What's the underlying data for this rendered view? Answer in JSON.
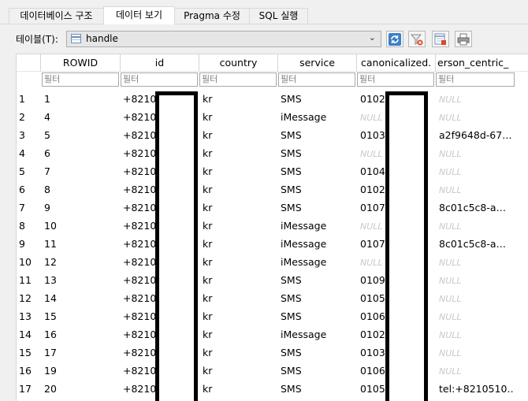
{
  "tabs": [
    {
      "label": "데이터베이스 구조",
      "active": false
    },
    {
      "label": "데이터 보기",
      "active": true
    },
    {
      "label": "Pragma 수정",
      "active": false
    },
    {
      "label": "SQL 실행",
      "active": false
    }
  ],
  "table_selector": {
    "label": "테이블(T):",
    "value": "handle"
  },
  "toolbar": {
    "buttons": [
      "refresh-icon",
      "clear-filters-icon",
      "save-table-icon",
      "print-icon"
    ]
  },
  "columns": [
    "ROWID",
    "id",
    "country",
    "service",
    "canonicalized_",
    "person_centric_"
  ],
  "column_header_display": [
    "ROWID",
    "id",
    "country",
    "service",
    "canonicalized.",
    "erson_centric_"
  ],
  "filter_placeholder": "필터",
  "null_text": "NULL",
  "rows": [
    {
      "rn": "1",
      "rowid": "1",
      "id": "+82102",
      "country": "kr",
      "service": "SMS",
      "canon": "01024",
      "person": ""
    },
    {
      "rn": "2",
      "rowid": "4",
      "id": "+82103",
      "country": "kr",
      "service": "iMessage",
      "canon": "",
      "person": ""
    },
    {
      "rn": "3",
      "rowid": "5",
      "id": "+82103",
      "country": "kr",
      "service": "SMS",
      "canon": "01031",
      "person": "a2f9648d-67…"
    },
    {
      "rn": "4",
      "rowid": "6",
      "id": "+82103",
      "country": "kr",
      "service": "SMS",
      "canon": "",
      "person": ""
    },
    {
      "rn": "5",
      "rowid": "7",
      "id": "+82104",
      "country": "kr",
      "service": "SMS",
      "canon": "01041",
      "person": ""
    },
    {
      "rn": "6",
      "rowid": "8",
      "id": "+82102",
      "country": "kr",
      "service": "SMS",
      "canon": "01028",
      "person": ""
    },
    {
      "rn": "7",
      "rowid": "9",
      "id": "+82107",
      "country": "kr",
      "service": "SMS",
      "canon": "01072",
      "person": "8c01c5c8-a…"
    },
    {
      "rn": "8",
      "rowid": "10",
      "id": "+82102",
      "country": "kr",
      "service": "iMessage",
      "canon": "",
      "person": ""
    },
    {
      "rn": "9",
      "rowid": "11",
      "id": "+82107",
      "country": "kr",
      "service": "iMessage",
      "canon": "01072",
      "person": "8c01c5c8-a…"
    },
    {
      "rn": "10",
      "rowid": "12",
      "id": "+82105",
      "country": "kr",
      "service": "iMessage",
      "canon": "",
      "person": ""
    },
    {
      "rn": "11",
      "rowid": "13",
      "id": "+82109",
      "country": "kr",
      "service": "SMS",
      "canon": "01095",
      "person": ""
    },
    {
      "rn": "12",
      "rowid": "14",
      "id": "+82105",
      "country": "kr",
      "service": "SMS",
      "canon": "01050",
      "person": ""
    },
    {
      "rn": "13",
      "rowid": "15",
      "id": "+82106",
      "country": "kr",
      "service": "SMS",
      "canon": "01062",
      "person": ""
    },
    {
      "rn": "14",
      "rowid": "16",
      "id": "+82102",
      "country": "kr",
      "service": "iMessage",
      "canon": "01028",
      "person": ""
    },
    {
      "rn": "15",
      "rowid": "17",
      "id": "+82103",
      "country": "kr",
      "service": "SMS",
      "canon": "01036",
      "person": ""
    },
    {
      "rn": "16",
      "rowid": "19",
      "id": "+82106",
      "country": "kr",
      "service": "SMS",
      "canon": "01066",
      "person": ""
    },
    {
      "rn": "17",
      "rowid": "20",
      "id": "+82105",
      "country": "kr",
      "service": "SMS",
      "canon": "01051",
      "person": "tel:+8210510…"
    }
  ]
}
